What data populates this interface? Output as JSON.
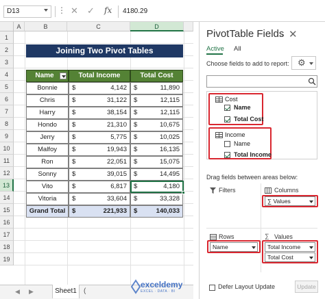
{
  "formula_bar": {
    "name_box": "D13",
    "fx": "fx",
    "value": "4180.29"
  },
  "columns": [
    "A",
    "B",
    "C",
    "D"
  ],
  "rows": [
    "1",
    "2",
    "3",
    "4",
    "5",
    "6",
    "7",
    "8",
    "9",
    "10",
    "11",
    "12",
    "13",
    "14",
    "15",
    "16",
    "17",
    "18",
    "19"
  ],
  "title": "Joining Two Pivot Tables",
  "table": {
    "headers": [
      "Name",
      "Total Income",
      "Total Cost"
    ],
    "currency": "$",
    "rows": [
      {
        "name": "Bonnie",
        "income": "4,142",
        "cost": "11,890"
      },
      {
        "name": "Chris",
        "income": "31,122",
        "cost": "12,115"
      },
      {
        "name": "Harry",
        "income": "38,154",
        "cost": "12,115"
      },
      {
        "name": "Hondo",
        "income": "21,310",
        "cost": "10,675"
      },
      {
        "name": "Jerry",
        "income": "5,775",
        "cost": "10,025"
      },
      {
        "name": "Malfoy",
        "income": "19,943",
        "cost": "16,135"
      },
      {
        "name": "Ron",
        "income": "22,051",
        "cost": "15,075"
      },
      {
        "name": "Sonny",
        "income": "39,015",
        "cost": "14,495"
      },
      {
        "name": "Vito",
        "income": "6,817",
        "cost": "4,180"
      },
      {
        "name": "Vitoria",
        "income": "33,604",
        "cost": "33,328"
      }
    ],
    "grand_total": {
      "label": "Grand Total",
      "income": "221,933",
      "cost": "140,033"
    }
  },
  "sheet_tab": "Sheet1",
  "more_tabs": "(",
  "pivot_panel": {
    "title": "PivotTable Fields",
    "tabs": [
      "Active",
      "All"
    ],
    "choose_text": "Choose fields to add to report:",
    "groups": [
      {
        "name": "Cost",
        "fields": [
          {
            "label": "Name",
            "checked": true
          },
          {
            "label": "Total Cost",
            "checked": true
          }
        ]
      },
      {
        "name": "Income",
        "fields": [
          {
            "label": "Name",
            "checked": false
          },
          {
            "label": "Total Income",
            "checked": true
          }
        ]
      }
    ],
    "drag_text": "Drag fields between areas below:",
    "areas": {
      "filters": "Filters",
      "columns": "Columns",
      "rows": "Rows",
      "values": "Values"
    },
    "columns_chip": "Values",
    "columns_sigma": "∑",
    "rows_chip": "Name",
    "values_chips": [
      "Total Income",
      "Total Cost"
    ],
    "defer_label": "Defer Layout Update",
    "update_label": "Update"
  },
  "watermark": {
    "brand": "exceldemy",
    "sub": "EXCEL · DATA · BI"
  }
}
